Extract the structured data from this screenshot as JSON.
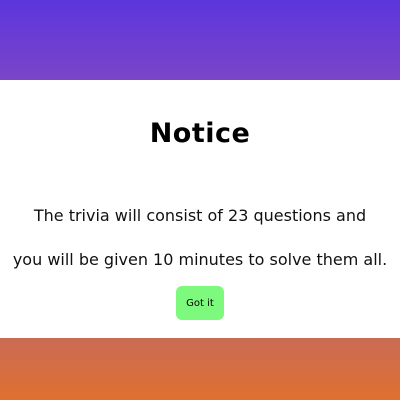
{
  "notice": {
    "title": "Notice",
    "message_line1": "The trivia will consist of 23 questions and",
    "message_line2": "you will be given 10 minutes to solve them all.",
    "button_label": "Got it"
  },
  "colors": {
    "top_band": "#5c35dc",
    "bottom_band": "#e07030",
    "button": "#7dfa7d"
  }
}
